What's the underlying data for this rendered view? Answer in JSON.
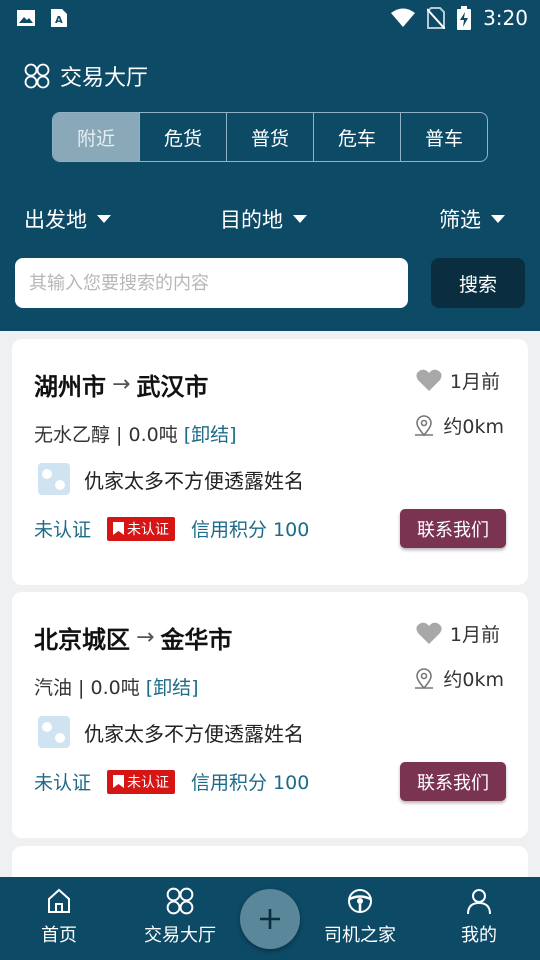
{
  "status_bar": {
    "time": "3:20"
  },
  "header": {
    "title": "交易大厅"
  },
  "tabs": [
    "附近",
    "危货",
    "普货",
    "危车",
    "普车"
  ],
  "filters": {
    "origin": "出发地",
    "destination": "目的地",
    "filter": "筛选"
  },
  "search": {
    "placeholder": "其输入您要搜索的内容",
    "button": "搜索"
  },
  "listings": [
    {
      "from": "湖州市",
      "arrow": "→",
      "to": "武汉市",
      "time": "1月前",
      "distance": "约0km",
      "cargo": "无水乙醇 | 0.0吨",
      "settlement": "[卸结]",
      "person": "仇家太多不方便透露姓名",
      "verify_status": "未认证",
      "badge": "未认证",
      "credit": "信用积分 100",
      "contact": "联系我们"
    },
    {
      "from": "北京城区",
      "arrow": "→",
      "to": "金华市",
      "time": "1月前",
      "distance": "约0km",
      "cargo": "汽油 | 0.0吨",
      "settlement": "[卸结]",
      "person": "仇家太多不方便透露姓名",
      "verify_status": "未认证",
      "badge": "未认证",
      "credit": "信用积分 100",
      "contact": "联系我们"
    }
  ],
  "bottom_nav": {
    "home": "首页",
    "hall": "交易大厅",
    "driver": "司机之家",
    "mine": "我的"
  },
  "colors": {
    "primary": "#0d4a66",
    "accent_button": "#7a3350",
    "badge_red": "#d61515",
    "link": "#1d6b89"
  }
}
